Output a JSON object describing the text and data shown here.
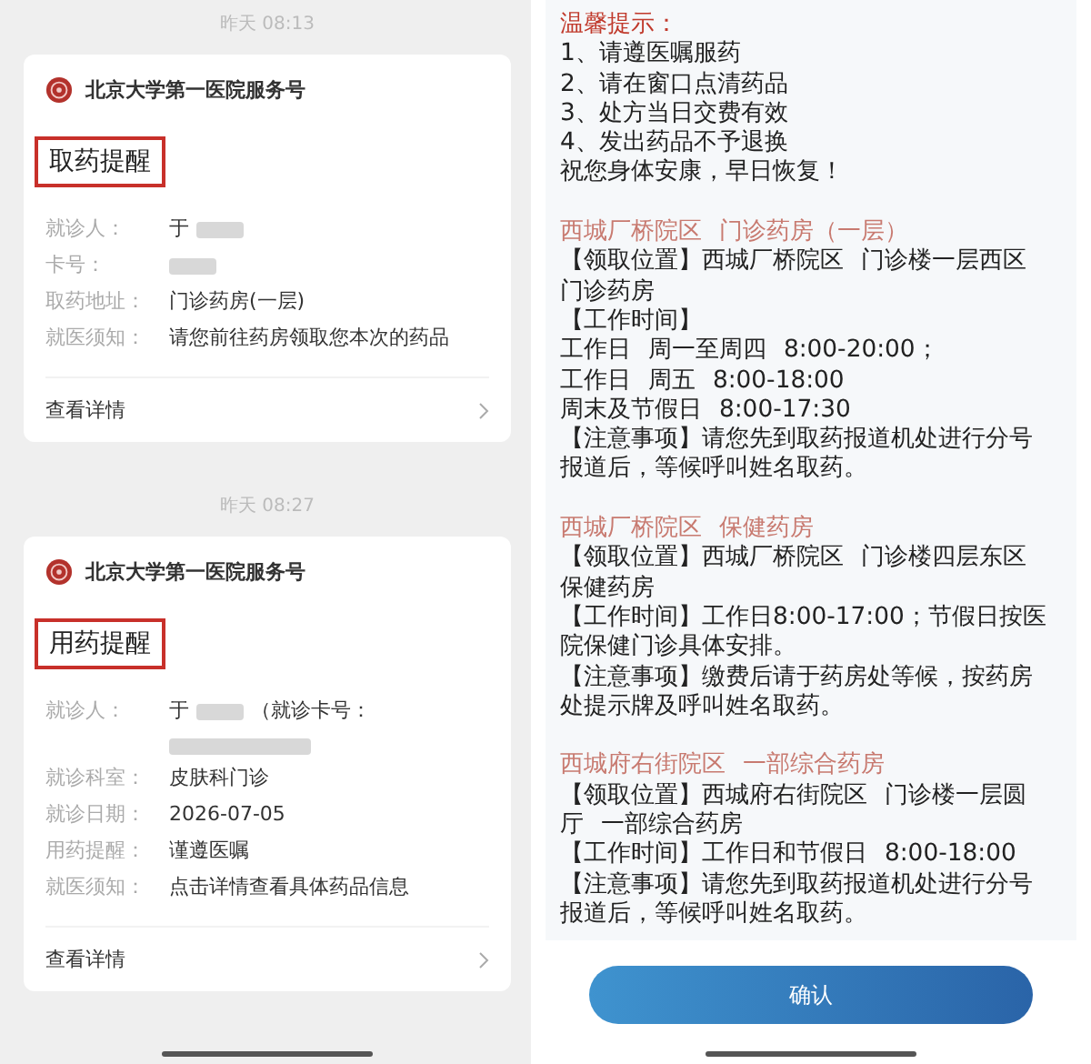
{
  "messages": [
    {
      "time": "昨天 08:13",
      "sender": "北京大学第一医院服务号",
      "title": "取药提醒",
      "fields": [
        {
          "label": "就诊人：",
          "parts": [
            {
              "kind": "text",
              "text": "于"
            },
            {
              "kind": "blur"
            }
          ]
        },
        {
          "label": "卡号：",
          "parts": [
            {
              "kind": "blur"
            }
          ]
        },
        {
          "label": "取药地址：",
          "parts": [
            {
              "kind": "text",
              "text": "门诊药房(一层)"
            }
          ]
        },
        {
          "label": "就医须知：",
          "parts": [
            {
              "kind": "text",
              "text": "请您前往药房领取您本次的药品"
            }
          ]
        }
      ],
      "link": "查看详情"
    },
    {
      "time": "昨天 08:27",
      "sender": "北京大学第一医院服务号",
      "title": "用药提醒",
      "fields": [
        {
          "label": "就诊人：",
          "parts": [
            {
              "kind": "text",
              "text": "于"
            },
            {
              "kind": "blur"
            },
            {
              "kind": "text",
              "text": "（就诊卡号："
            },
            {
              "kind": "break"
            },
            {
              "kind": "blur"
            }
          ]
        },
        {
          "label": "就诊科室：",
          "parts": [
            {
              "kind": "text",
              "text": "皮肤科门诊"
            }
          ]
        },
        {
          "label": "就诊日期：",
          "parts": [
            {
              "kind": "text",
              "text": "2026-07-05"
            }
          ]
        },
        {
          "label": "用药提醒：",
          "parts": [
            {
              "kind": "text",
              "text": "谨遵医嘱"
            }
          ]
        },
        {
          "label": "就医须知：",
          "parts": [
            {
              "kind": "text",
              "text": "点击详情查看具体药品信息"
            }
          ]
        }
      ],
      "link": "查看详情"
    }
  ],
  "notice": {
    "title": "温馨提示：",
    "lines": [
      "1、请遵医嘱服药",
      "2、请在窗口点清药品",
      "3、处方当日交费有效",
      "4、发出药品不予退换",
      "祝您身体安康，早日恢复！"
    ],
    "sections": [
      {
        "heading": "西城厂桥院区 门诊药房（一层）",
        "lines": [
          "【领取位置】西城厂桥院区 门诊楼一层西区门诊药房",
          "【工作时间】",
          "工作日 周一至周四 8:00-20:00；",
          "工作日 周五 8:00-18:00",
          "周末及节假日 8:00-17:30",
          "【注意事项】请您先到取药报道机处进行分号报道后，等候呼叫姓名取药。"
        ]
      },
      {
        "heading": "西城厂桥院区 保健药房",
        "lines": [
          "【领取位置】西城厂桥院区 门诊楼四层东区保健药房",
          "【工作时间】工作日8:00-17:00；节假日按医院保健门诊具体安排。",
          "【注意事项】缴费后请于药房处等候，按药房处提示牌及呼叫姓名取药。"
        ]
      },
      {
        "heading": "西城府右街院区 一部综合药房",
        "lines": [
          "【领取位置】西城府右街院区 门诊楼一层圆厅 一部综合药房",
          "【工作时间】工作日和节假日 8:00-18:00",
          "【注意事项】请您先到取药报道机处进行分号报道后，等候呼叫姓名取药。"
        ]
      }
    ]
  },
  "confirm_button": "确认"
}
